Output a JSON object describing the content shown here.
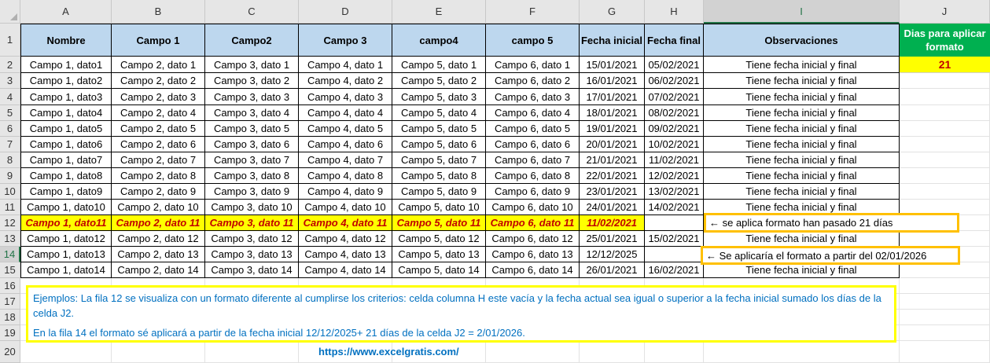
{
  "columns": [
    "A",
    "B",
    "C",
    "D",
    "E",
    "F",
    "G",
    "H",
    "I",
    "J"
  ],
  "row_numbers": [
    "1",
    "2",
    "3",
    "4",
    "5",
    "6",
    "7",
    "8",
    "9",
    "10",
    "11",
    "12",
    "13",
    "14",
    "15",
    "16",
    "17",
    "18",
    "19",
    "20"
  ],
  "headers": [
    "Nombre",
    "Campo 1",
    "Campo2",
    "Campo 3",
    "campo4",
    "campo 5",
    "Fecha inicial",
    "Fecha final",
    "Observaciones"
  ],
  "side_panel": {
    "title_line1": "Dias para aplicar",
    "title_line2": "formato",
    "value": "21",
    "header_color": "#00b050",
    "value_color": "#ffff00"
  },
  "rows": [
    [
      "Campo 1, dato1",
      "Campo 2, dato 1",
      "Campo 3, dato 1",
      "Campo 4, dato 1",
      "Campo 5, dato 1",
      "Campo 6, dato 1",
      "15/01/2021",
      "05/02/2021",
      "Tiene fecha inicial y final"
    ],
    [
      "Campo 1, dato2",
      "Campo 2, dato 2",
      "Campo 3, dato 2",
      "Campo 4, dato 2",
      "Campo 5, dato 2",
      "Campo 6, dato 2",
      "16/01/2021",
      "06/02/2021",
      "Tiene fecha inicial y final"
    ],
    [
      "Campo 1, dato3",
      "Campo 2, dato 3",
      "Campo 3, dato 3",
      "Campo 4, dato 3",
      "Campo 5, dato 3",
      "Campo 6, dato 3",
      "17/01/2021",
      "07/02/2021",
      "Tiene fecha inicial y final"
    ],
    [
      "Campo 1, dato4",
      "Campo 2, dato 4",
      "Campo 3, dato 4",
      "Campo 4, dato 4",
      "Campo 5, dato 4",
      "Campo 6, dato 4",
      "18/01/2021",
      "08/02/2021",
      "Tiene fecha inicial y final"
    ],
    [
      "Campo 1, dato5",
      "Campo 2, dato 5",
      "Campo 3, dato 5",
      "Campo 4, dato 5",
      "Campo 5, dato 5",
      "Campo 6, dato 5",
      "19/01/2021",
      "09/02/2021",
      "Tiene fecha inicial y final"
    ],
    [
      "Campo 1, dato6",
      "Campo 2, dato 6",
      "Campo 3, dato 6",
      "Campo 4, dato 6",
      "Campo 5, dato 6",
      "Campo 6, dato 6",
      "20/01/2021",
      "10/02/2021",
      "Tiene fecha inicial y final"
    ],
    [
      "Campo 1, dato7",
      "Campo 2, dato 7",
      "Campo 3, dato 7",
      "Campo 4, dato 7",
      "Campo 5, dato 7",
      "Campo 6, dato 7",
      "21/01/2021",
      "11/02/2021",
      "Tiene fecha inicial y final"
    ],
    [
      "Campo 1, dato8",
      "Campo 2, dato 8",
      "Campo 3, dato 8",
      "Campo 4, dato 8",
      "Campo 5, dato 8",
      "Campo 6, dato 8",
      "22/01/2021",
      "12/02/2021",
      "Tiene fecha inicial y final"
    ],
    [
      "Campo 1, dato9",
      "Campo 2, dato 9",
      "Campo 3, dato 9",
      "Campo 4, dato 9",
      "Campo 5, dato 9",
      "Campo 6, dato 9",
      "23/01/2021",
      "13/02/2021",
      "Tiene fecha inicial y final"
    ],
    [
      "Campo 1, dato10",
      "Campo 2, dato 10",
      "Campo 3, dato 10",
      "Campo 4, dato 10",
      "Campo 5, dato 10",
      "Campo 6, dato 10",
      "24/01/2021",
      "14/02/2021",
      "Tiene fecha inicial y final"
    ],
    [
      "Campo 1, dato11",
      "Campo 2, dato 11",
      "Campo 3, dato 11",
      "Campo 4, dato 11",
      "Campo 5, dato 11",
      "Campo 6, dato 11",
      "11/02/2021",
      "",
      ""
    ],
    [
      "Campo 1, dato12",
      "Campo 2, dato 12",
      "Campo 3, dato 12",
      "Campo 4, dato 12",
      "Campo 5, dato 12",
      "Campo 6, dato 12",
      "25/01/2021",
      "15/02/2021",
      "Tiene fecha inicial y final"
    ],
    [
      "Campo 1, dato13",
      "Campo 2, dato 13",
      "Campo 3, dato 13",
      "Campo 4, dato 13",
      "Campo 5, dato 13",
      "Campo 6, dato 13",
      "12/12/2025",
      "",
      ""
    ],
    [
      "Campo 1, dato14",
      "Campo 2, dato 14",
      "Campo 3, dato 14",
      "Campo 4, dato 14",
      "Campo 5, dato 14",
      "Campo 6, dato 14",
      "26/01/2021",
      "16/02/2021",
      "Tiene fecha inicial y final"
    ]
  ],
  "highlight_row_index": 10,
  "callouts": {
    "row12": "← se aplica formato han pasado 21 días",
    "row14": "←  Se aplicaría el formato a partir del 02/01/2026"
  },
  "note": {
    "line1": "Ejemplos:  La fila 12 se visualiza con un formato diferente al cumplirse los criterios: celda columna H este vacía y la fecha actual sea igual o superior a la fecha inicial sumado los días de la celda J2.",
    "line2": "En la fila 14 el formato sé aplicará a partir de la fecha inicial 12/12/2025+ 21 días de la celda J2 = 2/01/2026."
  },
  "link": "https://www.excelgratis.com/",
  "colors": {
    "header_bg": "#bdd7ee",
    "highlight_bg": "#ffff00",
    "highlight_text": "#c00000",
    "callout_border": "#ffc000",
    "note_text": "#0070c0"
  }
}
